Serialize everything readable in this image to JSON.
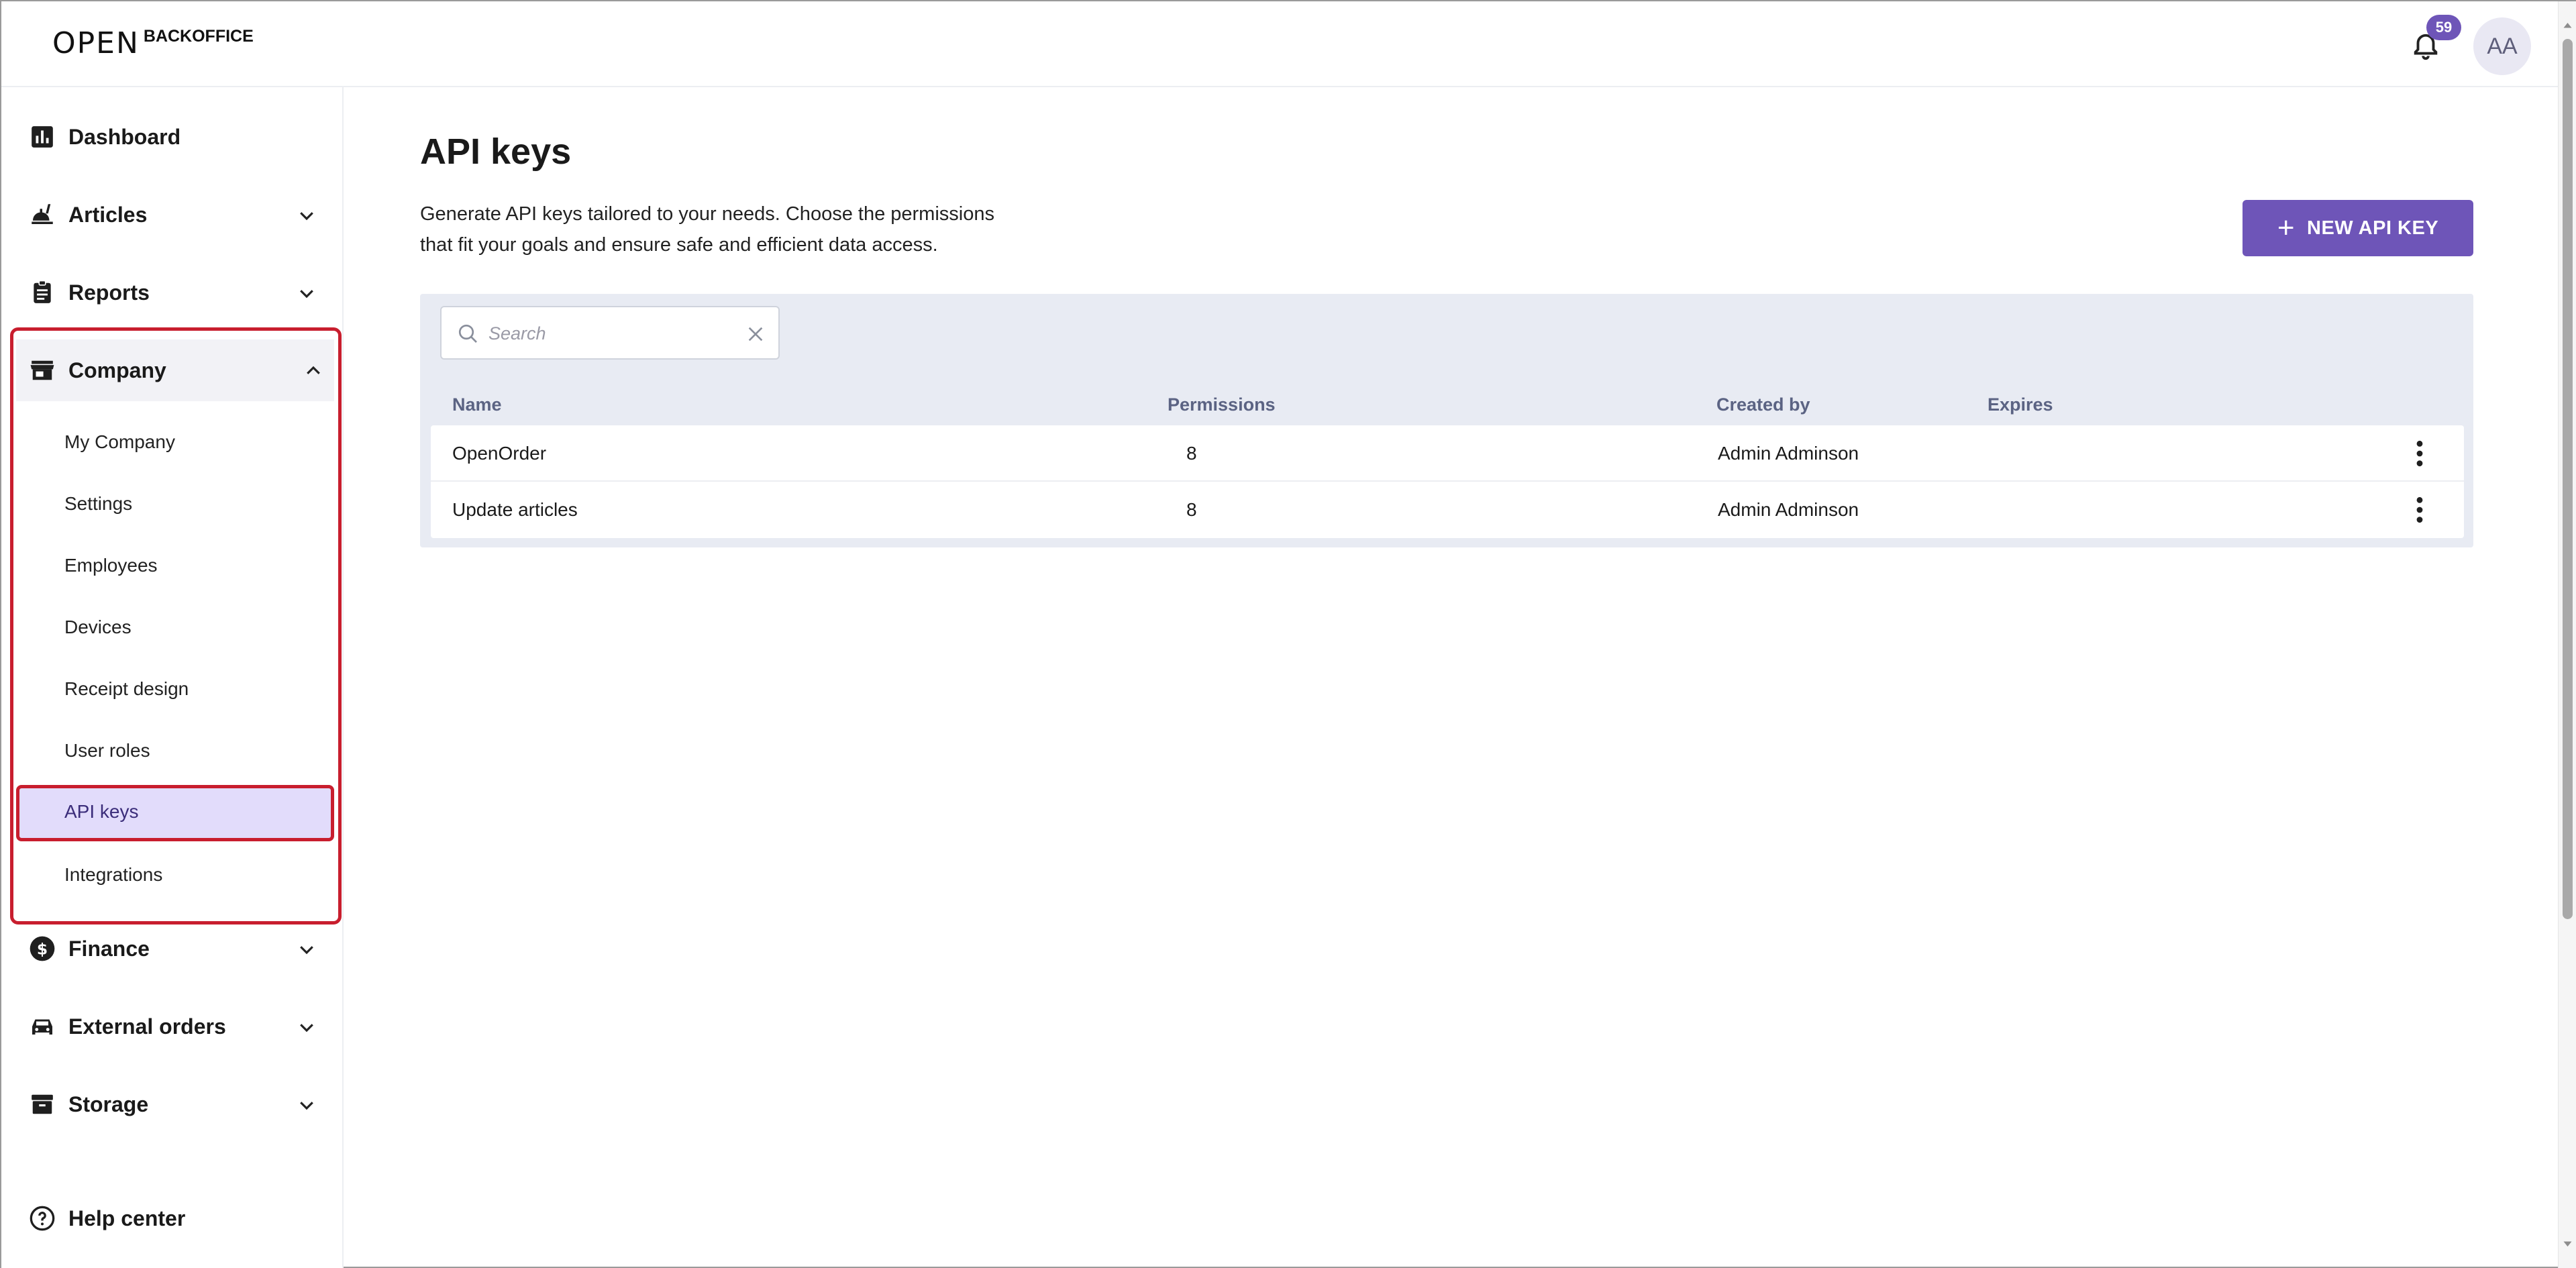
{
  "header": {
    "logo_mark": "OPEN",
    "logo_text": "BACKOFFICE",
    "notifications_count": "59",
    "avatar_initials": "AA"
  },
  "sidebar": {
    "items": [
      {
        "label": "Dashboard",
        "icon": "bar-chart-icon"
      },
      {
        "label": "Articles",
        "icon": "food-icon"
      },
      {
        "label": "Reports",
        "icon": "clipboard-icon"
      },
      {
        "label": "Company",
        "icon": "store-icon"
      },
      {
        "label": "Finance",
        "icon": "dollar-icon"
      },
      {
        "label": "External orders",
        "icon": "car-icon"
      },
      {
        "label": "Storage",
        "icon": "archive-icon"
      }
    ],
    "company_subitems": [
      "My Company",
      "Settings",
      "Employees",
      "Devices",
      "Receipt design",
      "User roles",
      "API keys",
      "Integrations"
    ],
    "help_label": "Help center"
  },
  "main": {
    "title": "API keys",
    "description": "Generate API keys tailored to your needs. Choose the permissions that fit your goals and ensure safe and efficient data access.",
    "new_button_label": "NEW API KEY",
    "search_placeholder": "Search",
    "columns": [
      "Name",
      "Permissions",
      "Created by",
      "Expires"
    ],
    "rows": [
      {
        "name": "OpenOrder",
        "permissions": "8",
        "created_by": "Admin Adminson",
        "expires": ""
      },
      {
        "name": "Update articles",
        "permissions": "8",
        "created_by": "Admin Adminson",
        "expires": ""
      }
    ]
  },
  "colors": {
    "accent": "#6e55b8",
    "highlight_border": "#c81e2e",
    "active_item_bg": "#e2dcfb",
    "table_bg": "#e8ebf3"
  }
}
